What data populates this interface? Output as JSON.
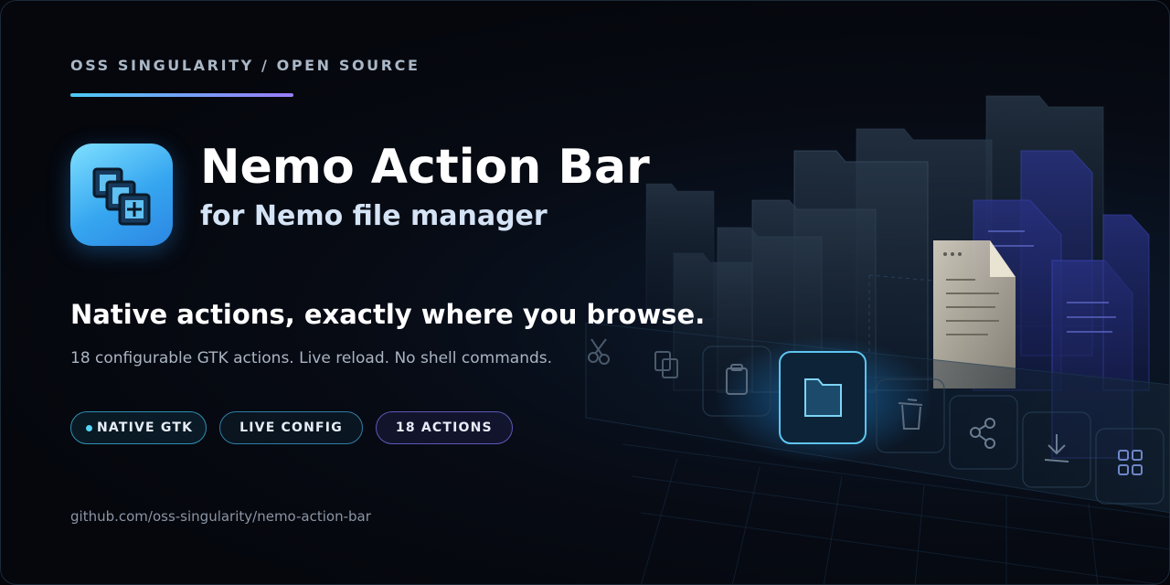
{
  "header": {
    "eyebrow": "OSS SINGULARITY / OPEN SOURCE"
  },
  "app": {
    "name": "Nemo Action Bar",
    "subtitle": "for Nemo file manager",
    "icon": "stacked-windows-icon"
  },
  "tagline": "Native actions, exactly where you browse.",
  "description": "18 configurable GTK actions. Live reload. No shell commands.",
  "badges": [
    {
      "label": "NATIVE GTK"
    },
    {
      "label": "LIVE CONFIG"
    },
    {
      "label": "18 ACTIONS"
    }
  ],
  "repo": "github.com/oss-singularity/nemo-action-bar",
  "toolbar_icons": [
    "scissors-icon",
    "copy-icon",
    "clipboard-icon",
    "folder-icon",
    "trash-icon",
    "share-icon",
    "download-icon",
    "grid-icon"
  ],
  "colors": {
    "background": "#05070d",
    "accent_cyan": "#4cc8f4",
    "accent_violet": "#9a7cf6",
    "text_primary": "#ffffff",
    "text_muted": "#aab4c2"
  }
}
